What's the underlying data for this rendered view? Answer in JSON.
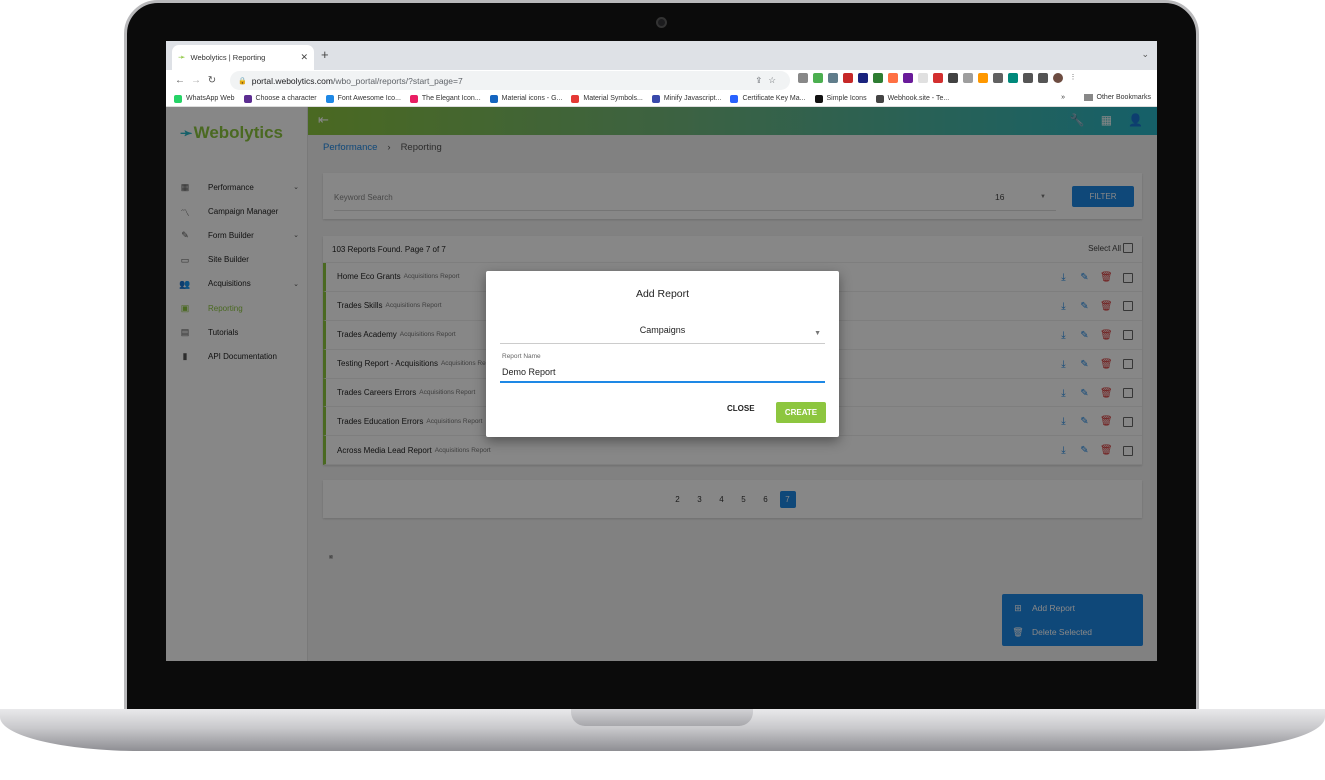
{
  "browser": {
    "tab_title": "Webolytics | Reporting",
    "url_host": "portal.webolytics.com",
    "url_path": "/wbo_portal/reports/?start_page=7",
    "bookmarks": [
      {
        "label": "WhatsApp Web",
        "color": "#25d366"
      },
      {
        "label": "Choose a character",
        "color": "#5c2d91"
      },
      {
        "label": "Font Awesome Ico...",
        "color": "#1e88e5"
      },
      {
        "label": "The Elegant Icon...",
        "color": "#e91e63"
      },
      {
        "label": "Material icons - G...",
        "color": "#1565c0"
      },
      {
        "label": "Material Symbols...",
        "color": "#e53935"
      },
      {
        "label": "Minify Javascript...",
        "color": "#3949ab"
      },
      {
        "label": "Certificate Key Ma...",
        "color": "#2962ff"
      },
      {
        "label": "Simple Icons",
        "color": "#111111"
      },
      {
        "label": "Webhook.site - Te...",
        "color": "#444444"
      }
    ],
    "bookmarks_overflow": "»",
    "other_bookmarks": "Other Bookmarks"
  },
  "app": {
    "logo_text": "Webolytics",
    "brand_green": "#8dc63f",
    "brand_blue": "#1e88e5",
    "sidebar": [
      {
        "label": "Performance",
        "icon": "dashboard-icon",
        "glyph": "▦",
        "expandable": true
      },
      {
        "label": "Campaign Manager",
        "icon": "trending-icon",
        "glyph": "〽",
        "expandable": false
      },
      {
        "label": "Form Builder",
        "icon": "form-icon",
        "glyph": "✎",
        "expandable": true
      },
      {
        "label": "Site Builder",
        "icon": "web-icon",
        "glyph": "▭",
        "expandable": false
      },
      {
        "label": "Acquisitions",
        "icon": "people-icon",
        "glyph": "👥",
        "expandable": true
      },
      {
        "label": "Reporting",
        "icon": "report-icon",
        "glyph": "▣",
        "expandable": false,
        "active": true
      },
      {
        "label": "Tutorials",
        "icon": "video-library-icon",
        "glyph": "▤",
        "expandable": false
      },
      {
        "label": "API Documentation",
        "icon": "book-icon",
        "glyph": "▮",
        "expandable": false
      }
    ],
    "breadcrumb": {
      "parent": "Performance",
      "current": "Reporting"
    },
    "filter": {
      "keyword_placeholder": "Keyword Search",
      "per_page": "16",
      "button": "FILTER"
    },
    "list": {
      "summary": "103 Reports Found. Page 7 of 7",
      "select_all": "Select All",
      "rows": [
        {
          "name": "Home Eco Grants",
          "type": "Acquisitions Report"
        },
        {
          "name": "Trades Skills",
          "type": "Acquisitions Report"
        },
        {
          "name": "Trades Academy",
          "type": "Acquisitions Report"
        },
        {
          "name": "Testing Report - Acquisitions",
          "type": "Acquisitions Report"
        },
        {
          "name": "Trades Careers Errors",
          "type": "Acquisitions Report"
        },
        {
          "name": "Trades Education Errors",
          "type": "Acquisitions Report"
        },
        {
          "name": "Across Media Lead Report",
          "type": "Acquisitions Report"
        }
      ]
    },
    "pagination": {
      "first": "«",
      "prev": "‹",
      "pages": [
        "2",
        "3",
        "4",
        "5",
        "6",
        "7"
      ],
      "current": "7",
      "next": "»"
    },
    "fab": {
      "add": "Add Report",
      "delete": "Delete Selected"
    }
  },
  "dialog": {
    "title": "Add Report",
    "select_value": "Campaigns",
    "field_label": "Report Name",
    "field_value": "Demo Report",
    "close": "CLOSE",
    "create": "CREATE"
  }
}
